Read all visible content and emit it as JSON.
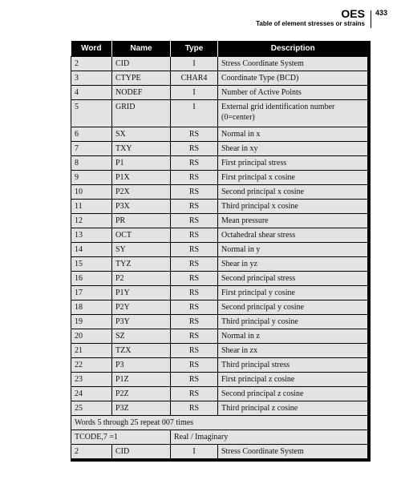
{
  "header": {
    "section": "OES",
    "subtitle": "Table of element stresses or strains",
    "page_number": "433"
  },
  "table": {
    "columns": [
      "Word",
      "Name",
      "Type",
      "Description"
    ],
    "rows": [
      {
        "word": "2",
        "name": "CID",
        "type": "I",
        "desc": "Stress Coordinate System"
      },
      {
        "word": "3",
        "name": "CTYPE",
        "type": "CHAR4",
        "desc": "Coordinate Type (BCD)"
      },
      {
        "word": "4",
        "name": "NODEF",
        "type": "I",
        "desc": "Number of Active Points"
      },
      {
        "word": "5",
        "name": "GRID",
        "type": "I",
        "desc": "External grid identification number (0=center)"
      },
      {
        "word": "6",
        "name": "SX",
        "type": "RS",
        "desc": "Normal in x"
      },
      {
        "word": "7",
        "name": "TXY",
        "type": "RS",
        "desc": "Shear in xy"
      },
      {
        "word": "8",
        "name": "P1",
        "type": "RS",
        "desc": "First principal stress"
      },
      {
        "word": "9",
        "name": "P1X",
        "type": "RS",
        "desc": "First principal x cosine"
      },
      {
        "word": "10",
        "name": "P2X",
        "type": "RS",
        "desc": "Second principal x cosine"
      },
      {
        "word": "11",
        "name": "P3X",
        "type": "RS",
        "desc": "Third principal x cosine"
      },
      {
        "word": "12",
        "name": "PR",
        "type": "RS",
        "desc": "Mean pressure"
      },
      {
        "word": "13",
        "name": "OCT",
        "type": "RS",
        "desc": "Octahedral shear stress"
      },
      {
        "word": "14",
        "name": "SY",
        "type": "RS",
        "desc": "Normal in y"
      },
      {
        "word": "15",
        "name": "TYZ",
        "type": "RS",
        "desc": "Shear in yz"
      },
      {
        "word": "16",
        "name": "P2",
        "type": "RS",
        "desc": "Second principal stress"
      },
      {
        "word": "17",
        "name": "P1Y",
        "type": "RS",
        "desc": "First principal y cosine"
      },
      {
        "word": "18",
        "name": "P2Y",
        "type": "RS",
        "desc": "Second principal y cosine"
      },
      {
        "word": "19",
        "name": "P3Y",
        "type": "RS",
        "desc": "Third principal y cosine"
      },
      {
        "word": "20",
        "name": "SZ",
        "type": "RS",
        "desc": "Normal in z"
      },
      {
        "word": "21",
        "name": "TZX",
        "type": "RS",
        "desc": "Shear in zx"
      },
      {
        "word": "22",
        "name": "P3",
        "type": "RS",
        "desc": "Third principal stress"
      },
      {
        "word": "23",
        "name": "P1Z",
        "type": "RS",
        "desc": "First principal z cosine"
      },
      {
        "word": "24",
        "name": "P2Z",
        "type": "RS",
        "desc": "Second principal z cosine"
      },
      {
        "word": "25",
        "name": "P3Z",
        "type": "RS",
        "desc": "Third principal z cosine"
      }
    ],
    "repeat_note": "Words 5 through 25 repeat 007 times",
    "tcode_label": "TCODE,7 =1",
    "tcode_value": "Real / Imaginary",
    "final_row": {
      "word": "2",
      "name": "CID",
      "type": "I",
      "desc": "Stress Coordinate System"
    }
  }
}
